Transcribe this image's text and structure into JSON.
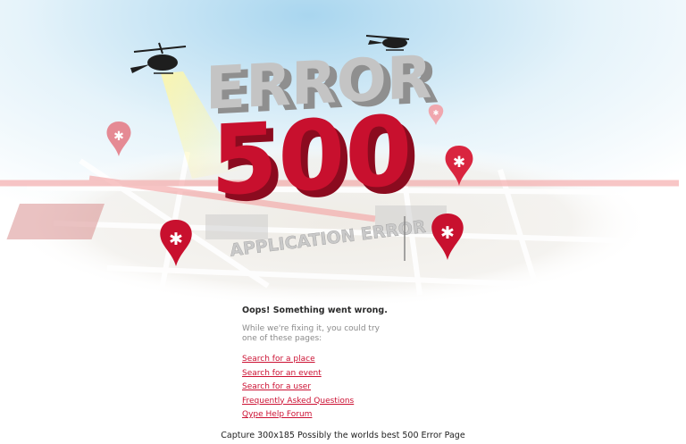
{
  "hero": {
    "word_error": "ERROR",
    "code": "500",
    "subtitle": "APPLICATION ERROR",
    "accent": "#c8102e",
    "grey": "#bdbdbd"
  },
  "message": {
    "title": "Oops! Something went wrong.",
    "hint": "While we're fixing it, you could try one of these pages:"
  },
  "links": [
    {
      "label": "Search for a place"
    },
    {
      "label": "Search for an event"
    },
    {
      "label": "Search for a user"
    },
    {
      "label": "Frequently Asked Questions"
    },
    {
      "label": "Qype Help Forum"
    }
  ],
  "caption": "Capture 300x185 Possibly the worlds best 500 Error Page",
  "icons": {
    "marker": "map-marker-icon",
    "helicopter": "helicopter-icon"
  }
}
